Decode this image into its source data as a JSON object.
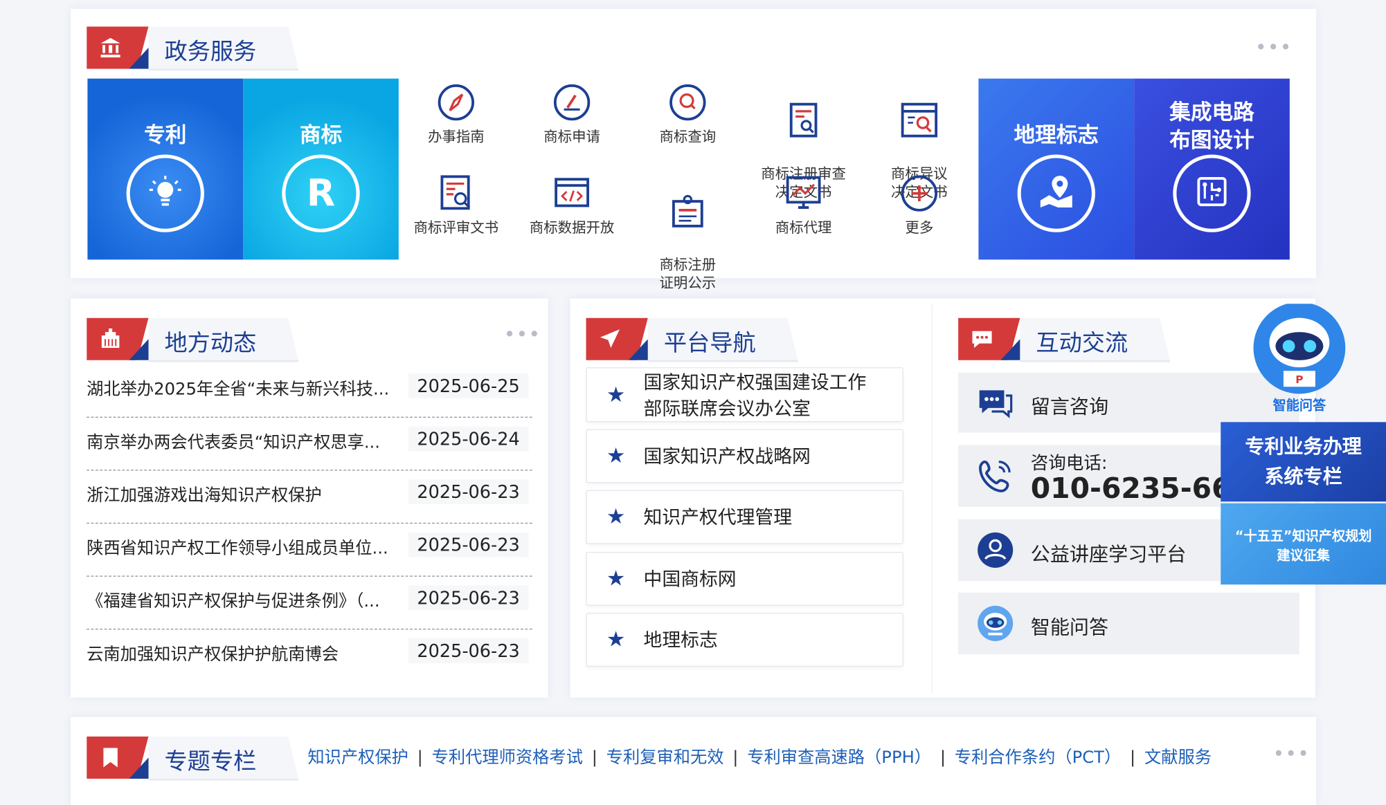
{
  "sections": {
    "gov_service": "政务服务",
    "local_news": "地方动态",
    "platform_nav": "平台导航",
    "interaction": "互动交流",
    "topics": "专题专栏"
  },
  "big_tiles": [
    {
      "label": "专利",
      "color": "#1d6fe0"
    },
    {
      "label": "商标",
      "color": "#0bb0e8"
    },
    {
      "label": "地理标志",
      "color": "#2f5be8"
    },
    {
      "label": "集成电路\n布图设计",
      "color": "#2a3ed0"
    }
  ],
  "services": [
    {
      "label": "办事指南",
      "icon": "compass-icon"
    },
    {
      "label": "商标申请",
      "icon": "edit-icon"
    },
    {
      "label": "商标查询",
      "icon": "search-icon"
    },
    {
      "label": "商标注册审查\n决定文书",
      "icon": "doc-search-icon"
    },
    {
      "label": "商标异议\n决定文书",
      "icon": "screen-search-icon"
    },
    {
      "label": "商标评审文书",
      "icon": "review-doc-icon"
    },
    {
      "label": "商标数据开放",
      "icon": "code-icon"
    },
    {
      "label": "商标注册\n证明公示",
      "icon": "certificate-icon"
    },
    {
      "label": "商标代理",
      "icon": "chart-screen-icon"
    },
    {
      "label": "更多",
      "icon": "plus-icon"
    }
  ],
  "news": [
    {
      "title": "湖北举办2025年全省“未来与新兴科技...",
      "date": "2025-06-25"
    },
    {
      "title": "南京举办两会代表委员“知识产权思享...",
      "date": "2025-06-24"
    },
    {
      "title": "浙江加强游戏出海知识产权保护",
      "date": "2025-06-23"
    },
    {
      "title": "陕西省知识产权工作领导小组成员单位...",
      "date": "2025-06-23"
    },
    {
      "title": "《福建省知识产权保护与促进条例》（...",
      "date": "2025-06-23"
    },
    {
      "title": "云南加强知识产权保护护航南博会",
      "date": "2025-06-23"
    }
  ],
  "nav_links": [
    "国家知识产权强国建设工作\n部际联席会议办公室",
    "国家知识产权战略网",
    "知识产权代理管理",
    "中国商标网",
    "地理标志"
  ],
  "interaction": {
    "consult": "留言咨询",
    "phone_label": "咨询电话:",
    "phone_number": "010-6235-66",
    "lecture": "公益讲座学习平台",
    "qa": "智能问答"
  },
  "float": {
    "robot_label": "智能问答",
    "patent_banner": "专利业务办理\n系统专栏",
    "plan_banner": "“十五五”知识产权规划\n建议征集"
  },
  "topic_links": [
    "知识产权保护",
    "专利代理师资格考试",
    "专利复审和无效",
    "专利审查高速路（PPH）",
    "专利合作条约（PCT）",
    "文献服务"
  ],
  "colors": {
    "brand_blue": "#1d3f93",
    "brand_red": "#d43a3a",
    "link_blue": "#1d5fb8"
  }
}
